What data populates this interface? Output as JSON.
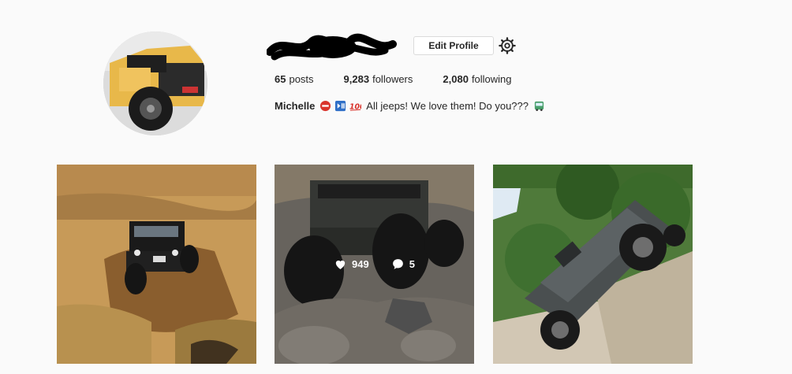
{
  "profile": {
    "edit_label": "Edit Profile",
    "stats": [
      {
        "count": "65",
        "label": "posts"
      },
      {
        "count": "9,283",
        "label": "followers"
      },
      {
        "count": "2,080",
        "label": "following"
      }
    ],
    "bio": {
      "name": "Michelle",
      "text": "All jeeps! We love them! Do you???"
    }
  },
  "posts": [
    {
      "likes": "",
      "comments": ""
    },
    {
      "likes": "949",
      "comments": "5"
    },
    {
      "likes": "",
      "comments": ""
    }
  ],
  "colors": {
    "background": "#fafafa",
    "jeep_yellow": "#e8b84a",
    "text": "#262626"
  },
  "icons": [
    "gear-icon",
    "heart-icon",
    "comment-icon"
  ]
}
